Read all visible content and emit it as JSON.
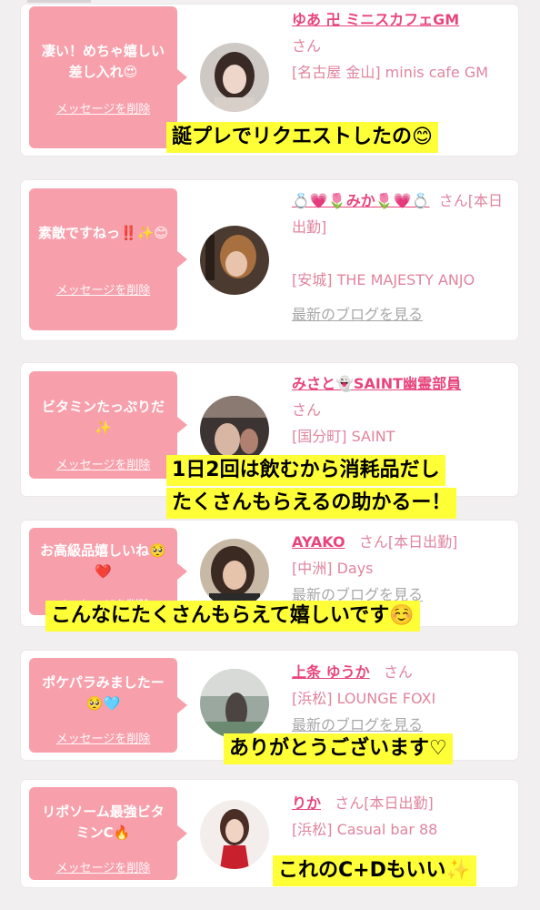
{
  "cards": [
    {
      "message": "凄い！めちゃ嬉しい差し入れ😍",
      "delete_label": "メッセージを削除",
      "name": "ゆあ 卍 ミニスカフェGM",
      "san": "さん",
      "shop": "[名古屋 金山] minis cafe GM",
      "blog": ""
    },
    {
      "message": "素敵ですねっ‼️✨😊",
      "delete_label": "メッセージを削除",
      "name": "💍💗🌷みか🌷💗💍",
      "san": "さん",
      "tag": "[本日出勤]",
      "shop": "[安城] THE MAJESTY ANJO",
      "blog": "最新のブログを見る"
    },
    {
      "message": "ビタミンたっぷりだ✨",
      "delete_label": "メッセージを削除",
      "name": "みさと👻SAINT幽霊部員",
      "san": "さん",
      "shop": "[国分町] SAINT",
      "blog": ""
    },
    {
      "message": "お高級品嬉しいね🥺❤️",
      "delete_label": "メッセージを削除",
      "name": "AYAKO",
      "san": "さん",
      "tag": "[本日出勤]",
      "shop": "[中洲] Days",
      "blog": "最新のブログを見る"
    },
    {
      "message": "ポケパラみましたー🥺🩵",
      "delete_label": "メッセージを削除",
      "name": "上条 ゆうか",
      "san": "さん",
      "shop": "[浜松] LOUNGE FOXI",
      "blog": "最新のブログを見る"
    },
    {
      "message": "リポソーム最強ビタミンC🔥",
      "delete_label": "メッセージを削除",
      "name": "りか",
      "san": "さん",
      "tag": "[本日出勤]",
      "shop": "[浜松] Casual bar 88",
      "blog": ""
    }
  ],
  "overlays": {
    "o1": "誕プレでリクエストしたの😊",
    "o2a": "1日2回は飲むから消耗品だし",
    "o2b": "たくさんもらえるの助かるー！",
    "o3": "こんなにたくさんもらえて嬉しいです☺️",
    "o4": "ありがとうございます♡",
    "o5": "これのC+Dもいい✨"
  },
  "colors": {
    "bubble": "#f7a0ac",
    "name": "#e8457d",
    "shop": "#e0849f",
    "highlight": "#ffff38"
  }
}
